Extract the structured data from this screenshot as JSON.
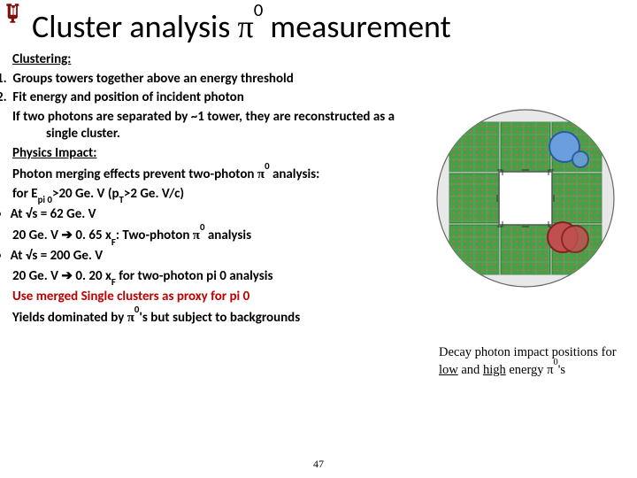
{
  "logo": {
    "alt": "IU trident logo",
    "fill": "#7D110C"
  },
  "title": {
    "pre": "Cluster analysis ",
    "pi": "π",
    "sup": "0",
    "post": " measurement"
  },
  "text": {
    "clustering_head": "Clustering:",
    "item1_num": "1.",
    "item1": "Groups towers together above an energy threshold",
    "item2_num": "2.",
    "item2": "Fit energy and position of incident photon",
    "sep_note": "If two photons are separated by ~1 tower, they are reconstructed as a single cluster.",
    "physics_head": "Physics Impact:",
    "merge_line_a": "Photon merging effects prevent two-photon ",
    "merge_line_pi": "π",
    "merge_line_sup": "0",
    "merge_line_b": " analysis:",
    "cond_line_a": "for E",
    "cond_line_sub1": "pi 0",
    "cond_line_b": ">20 Ge. V (p",
    "cond_line_sub2": "T",
    "cond_line_c": ">2 Ge. V/c)",
    "b1a": "At √s = 62 Ge. V",
    "b1b_a": "20 Ge. V ",
    "b1b_arrow": "➔",
    "b1b_b": " 0. 65 x",
    "b1b_sub": "F",
    "b1b_c": ": Two-photon ",
    "b1b_pi": "π",
    "b1b_sup": "0",
    "b1b_d": " analysis",
    "b2a": "At √s = 200 Ge. V",
    "b2b_a": "20 Ge. V ",
    "b2b_arrow": "➔",
    "b2b_b": " 0. 20 x",
    "b2b_sub": "F",
    "b2b_c": " for two-photon pi 0 analysis",
    "use_line": "Use merged Single clusters as proxy for pi 0",
    "yields_a": "Yields dominated by ",
    "yields_pi": "π",
    "yields_sup": "0",
    "yields_b": "'s but subject to backgrounds"
  },
  "caption": {
    "a": "Decay photon impact positions for ",
    "low": "low",
    "b": " and ",
    "high": "high",
    "c": " energy ",
    "pi": "π",
    "sup": "0",
    "d": "'s"
  },
  "pagenum": "47",
  "detector": {
    "bg": "#e0e0e0",
    "module_fill": "#46a046",
    "module_stroke": "#2c6b2c",
    "grid_stroke": "#8aa08a",
    "dot": "#d06060",
    "cluster1_fill": "#6a9edc",
    "cluster1_stroke": "#2a5aa0",
    "cluster2_fill": "#c05050",
    "cluster2_stroke": "#802020"
  }
}
